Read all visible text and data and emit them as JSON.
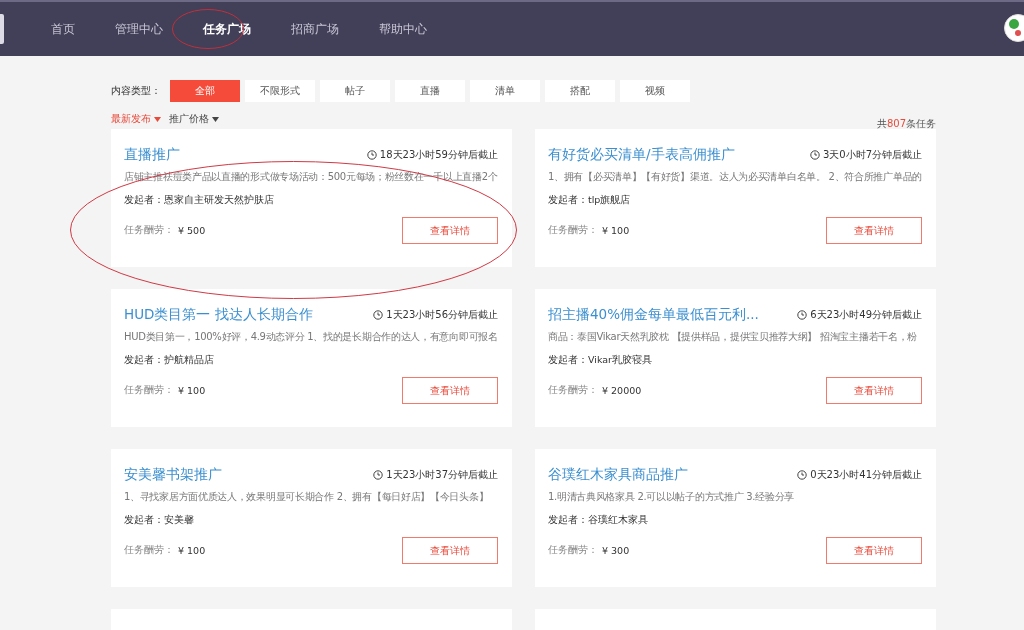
{
  "nav": {
    "items": [
      {
        "label": "首页",
        "selected": false
      },
      {
        "label": "管理中心",
        "selected": false
      },
      {
        "label": "任务广场",
        "selected": true
      },
      {
        "label": "招商广场",
        "selected": false
      },
      {
        "label": "帮助中心",
        "selected": false
      }
    ]
  },
  "filter": {
    "label": "内容类型：",
    "options": [
      {
        "label": "全部",
        "selected": true
      },
      {
        "label": "不限形式",
        "selected": false
      },
      {
        "label": "帖子",
        "selected": false
      },
      {
        "label": "直播",
        "selected": false
      },
      {
        "label": "清单",
        "selected": false
      },
      {
        "label": "搭配",
        "selected": false
      },
      {
        "label": "视频",
        "selected": false
      }
    ]
  },
  "sort": [
    {
      "label": "最新发布",
      "selected": true
    },
    {
      "label": "推广价格",
      "selected": false
    }
  ],
  "total": {
    "prefix": "共",
    "count": "807",
    "suffix": "条任务"
  },
  "tasks": [
    {
      "kind": "task",
      "title": "直播推广",
      "deadline": "18天23小时59分钟后截止",
      "description": "店铺主推祛痘类产品以直播的形式做专场活动：500元每场；粉丝数在一千以上直播2个",
      "publisher": "发起者：恩家自主研发天然护肤店",
      "reward_label": "任务酬劳：",
      "reward": "¥ 500",
      "button": "查看详情"
    },
    {
      "kind": "task",
      "title": "有好货必买清单/手表高佣推广",
      "deadline": "3天0小时7分钟后截止",
      "description": "1、拥有【必买清单】【有好货】渠道。达人为必买清单白名单。 2、符合所推广单品的",
      "publisher": "发起者：tlp旗舰店",
      "reward_label": "任务酬劳：",
      "reward": "¥ 100",
      "button": "查看详情"
    },
    {
      "kind": "task",
      "title": "HUD类目第一 找达人长期合作",
      "deadline": "1天23小时56分钟后截止",
      "description": "HUD类目第一，100%好评，4.9动态评分 1、找的是长期合作的达人，有意向即可报名",
      "publisher": "发起者：护航精品店",
      "reward_label": "任务酬劳：",
      "reward": "¥ 100",
      "button": "查看详情"
    },
    {
      "kind": "task",
      "title": "招主播40%佣金每单最低百元利...",
      "deadline": "6天23小时49分钟后截止",
      "description": "商品：泰国Vikar天然乳胶枕 【提供样品，提供宝贝推荐大纲】 招淘宝主播若干名，粉",
      "publisher": "发起者：Vikar乳胶寝具",
      "reward_label": "任务酬劳：",
      "reward": "¥ 20000",
      "button": "查看详情"
    },
    {
      "kind": "task",
      "title": "安美馨书架推广",
      "deadline": "1天23小时37分钟后截止",
      "description": "1、寻找家居方面优质达人，效果明显可长期合作 2、拥有【每日好店】【今日头条】",
      "publisher": "发起者：安美馨",
      "reward_label": "任务酬劳：",
      "reward": "¥ 100",
      "button": "查看详情"
    },
    {
      "kind": "task",
      "title": "谷璞红木家具商品推广",
      "deadline": "0天23小时41分钟后截止",
      "description": "1.明清古典风格家具 2.可以以帖子的方式推广 3.经验分享",
      "publisher": "发起者：谷璞红木家具",
      "reward_label": "任务酬劳：",
      "reward": "¥ 300",
      "button": "查看详情"
    },
    {
      "kind": "empty"
    },
    {
      "kind": "empty"
    }
  ]
}
